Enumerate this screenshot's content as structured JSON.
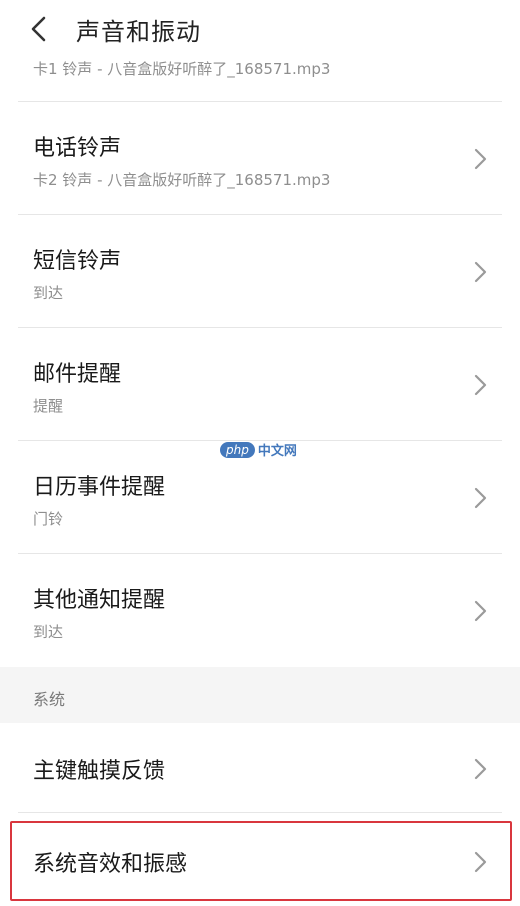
{
  "header": {
    "title": "声音和振动",
    "back_icon": "chevron-left-icon"
  },
  "partial_row": {
    "subtitle": "卡1 铃声 - 八音盒版好听醉了_168571.mp3"
  },
  "rows": [
    {
      "title": "电话铃声",
      "subtitle": "卡2 铃声 - 八音盒版好听醉了_168571.mp3"
    },
    {
      "title": "短信铃声",
      "subtitle": "到达"
    },
    {
      "title": "邮件提醒",
      "subtitle": "提醒"
    },
    {
      "title": "日历事件提醒",
      "subtitle": "门铃"
    },
    {
      "title": "其他通知提醒",
      "subtitle": "到达"
    }
  ],
  "section": {
    "label": "系统",
    "items": [
      {
        "title": "主键触摸反馈"
      },
      {
        "title": "系统音效和振感"
      }
    ]
  },
  "watermark": {
    "badge": "php",
    "text": "中文网"
  },
  "colors": {
    "highlight_border": "#d9363e",
    "section_bg": "#f5f5f5",
    "subtitle_text": "#8e8e8e"
  }
}
